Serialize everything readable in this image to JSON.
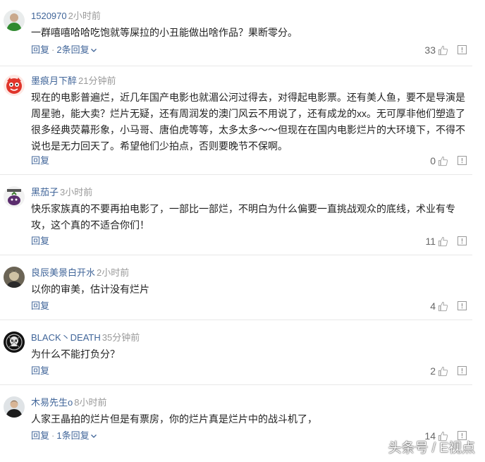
{
  "comments": [
    {
      "user": "1520970",
      "time": "2小时前",
      "text": "一群嘻嘻哈哈吃饱就等屎拉的小丑能做出啥作品？果断零分。",
      "reply_label": "回复",
      "sep": "·",
      "replies_label": "2条回复",
      "likes": "33",
      "avatar_icon": "green-shirt-person-avatar"
    },
    {
      "user": "墨痕月下醉",
      "time": "21分钟前",
      "text": "现在的电影普遍烂，近几年国产电影也就湄公河过得去，对得起电影票。还有美人鱼，要不是导演是周星驰，能大卖？烂片无疑，还有周润发的澳门风云不用说了，还有成龙的xx。无可厚非他们塑造了很多经典荧幕形象，小马哥、唐伯虎等等，太多太多～～但现在在国内电影烂片的大环境下，不得不说也是无力回天了。希望他们少拍点，否则要晚节不保啊。",
      "reply_label": "回复",
      "likes": "0",
      "avatar_icon": "red-cartoon-avatar"
    },
    {
      "user": "黑茄子",
      "time": "3小时前",
      "text": "快乐家族真的不要再拍电影了，一部比一部烂，不明白为什么偏要一直挑战观众的底线，术业有专攻，这个真的不适合你们！",
      "reply_label": "回复",
      "likes": "11",
      "avatar_icon": "purple-eggplant-avatar"
    },
    {
      "user": "良辰美景白开水",
      "time": "2小时前",
      "text": "以你的审美，估计没有烂片",
      "reply_label": "回复",
      "likes": "4",
      "avatar_icon": "dark-portrait-avatar"
    },
    {
      "user": "BLACK丶DEATH",
      "time": "35分钟前",
      "text": "为什么不能打负分？",
      "reply_label": "回复",
      "likes": "2",
      "avatar_icon": "skull-emblem-avatar"
    },
    {
      "user": "木易先生o",
      "time": "8小时前",
      "text": "人家王晶拍的烂片但是有票房，你的烂片真是烂片中的战斗机了，",
      "reply_label": "回复",
      "sep": "·",
      "replies_label": "1条回复",
      "likes": "14",
      "avatar_icon": "man-dark-jacket-avatar"
    }
  ],
  "watermark": "头条号 / E视点",
  "colors": {
    "username": "#406599",
    "time": "#999999",
    "action": "#406599",
    "text": "#222222",
    "divider": "#e8e8e8"
  }
}
